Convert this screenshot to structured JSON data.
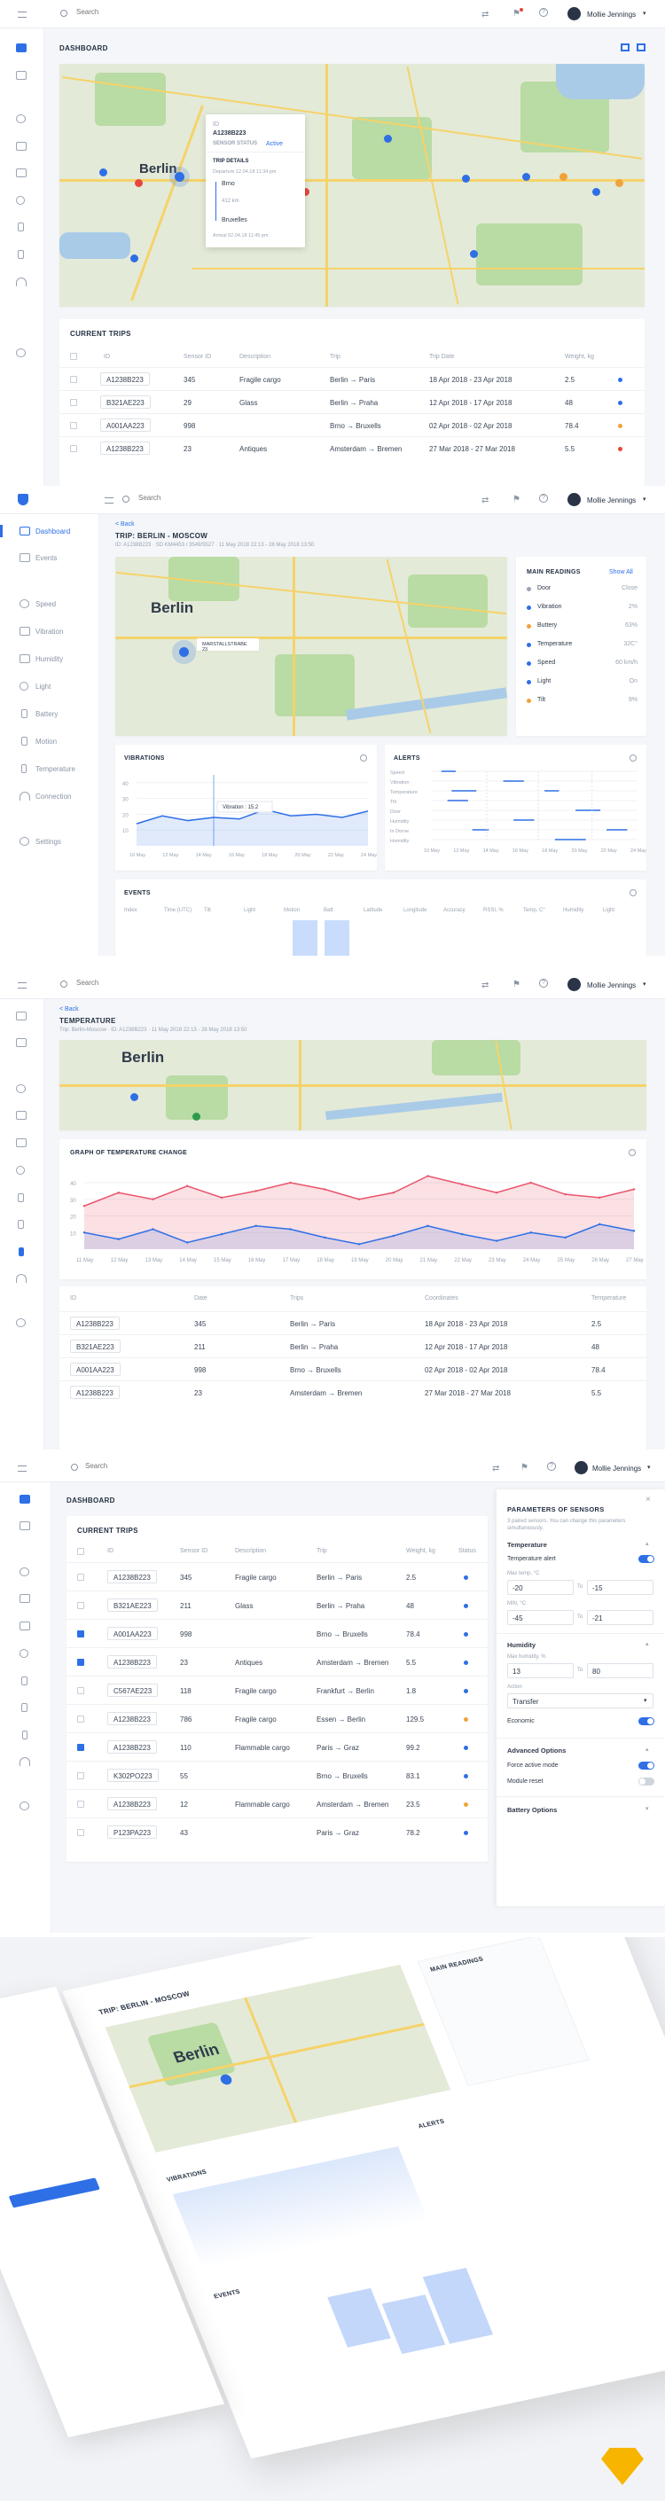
{
  "user": {
    "name": "Mollie Jennings"
  },
  "search": {
    "placeholder": "Search"
  },
  "dashboard": {
    "title": "DASHBOARD",
    "map": {
      "city_label": "Berlin",
      "popup": {
        "id_label": "ID",
        "id_value": "A1238B223",
        "status_label": "SENSOR STATUS",
        "status_value": "Active",
        "details_label": "TRIP DETAILS",
        "departure": "Departure 12.04.18 11:34 pm",
        "from": "Brno",
        "distance": "412 km",
        "to": "Bruxelles",
        "arrival": "Arrival 02.04.18 11:45 pm"
      }
    },
    "trips_title": "CURRENT TRIPS",
    "columns": [
      "ID",
      "Sensor ID",
      "Description",
      "Trip",
      "Trip Date",
      "Weight, kg"
    ],
    "rows": [
      {
        "id": "A1238B223",
        "sensor": "345",
        "desc": "Fragile cargo",
        "trip": "Berlin → Paris",
        "date": "18 Apr 2018 - 23 Apr 2018",
        "weight": "2.5",
        "status": "#2e6fe6"
      },
      {
        "id": "B321AE223",
        "sensor": "29",
        "desc": "Glass",
        "trip": "Berlin → Praha",
        "date": "12 Apr 2018 - 17 Apr 2018",
        "weight": "48",
        "status": "#2e6fe6"
      },
      {
        "id": "A001AA223",
        "sensor": "998",
        "desc": "",
        "trip": "Brno → Bruxells",
        "date": "02 Apr 2018 - 02 Apr 2018",
        "weight": "78.4",
        "status": "#f0a23b"
      },
      {
        "id": "A1238B223",
        "sensor": "23",
        "desc": "Antiques",
        "trip": "Amsterdam → Bremen",
        "date": "27 Mar 2018 - 27 Mar 2018",
        "weight": "5.5",
        "status": "#e8453c"
      }
    ]
  },
  "trip": {
    "back": "< Back",
    "title": "TRIP: BERLIN - MOSCOW",
    "meta": "ID: A1238B223 · SD KM4453 / 3549/5527 · 11 May 2018 22:13 - 28 May 2018 13:50",
    "sidebar": [
      "Dashboard",
      "Events",
      "Speed",
      "Vibration",
      "Humidity",
      "Light",
      "Battery",
      "Motion",
      "Temperature",
      "Connection",
      "Settings"
    ],
    "readings_title": "MAIN READINGS",
    "show_all": "Show All",
    "readings": [
      {
        "name": "Door",
        "value": "Close"
      },
      {
        "name": "Vibration",
        "value": "2%"
      },
      {
        "name": "Buttery",
        "value": "63%"
      },
      {
        "name": "Temperature",
        "value": "32C°"
      },
      {
        "name": "Speed",
        "value": "60 km/h"
      },
      {
        "name": "Light",
        "value": "On"
      },
      {
        "name": "Tilt",
        "value": "9%"
      }
    ],
    "map_tooltip": "MARSTALLSTRABE 23",
    "vibrations_title": "VIBRATIONS",
    "vib_tooltip": "Vibration : 15.2",
    "alerts_title": "ALERTS",
    "alert_rows": [
      "Speed",
      "Vibration",
      "Temperature",
      "Tilt",
      "Door",
      "Humidity",
      "In Dorne",
      "Humidity"
    ],
    "events_title": "EVENTS",
    "event_cols": [
      "Index",
      "Time (UTC)",
      "Tilt",
      "Light",
      "Motion",
      "Batt",
      "Latitude",
      "Longitude",
      "Accuracy",
      "RSSI, %",
      "Temp, C°",
      "Humidity",
      "Light"
    ]
  },
  "temperature": {
    "back": "< Back",
    "title": "TEMPERATURE",
    "meta": "Trip: Berlin-Moscow · ID: A1238B223 · 11 May 2018 22:13 - 28 May 2018 13:50",
    "graph_title": "GRAPH OF TEMPERATURE CHANGE",
    "columns": [
      "ID",
      "Date",
      "Trips",
      "Coordinates",
      "Temperature"
    ],
    "rows": [
      {
        "id": "A1238B223",
        "date": "345",
        "trip": "Berlin → Paris",
        "coords": "18 Apr 2018 - 23 Apr 2018",
        "temp": "2.5"
      },
      {
        "id": "B321AE223",
        "date": "211",
        "trip": "Berlin → Praha",
        "coords": "12 Apr 2018 - 17 Apr 2018",
        "temp": "48"
      },
      {
        "id": "A001AA223",
        "date": "998",
        "trip": "Brno → Bruxells",
        "coords": "02 Apr 2018 - 02 Apr 2018",
        "temp": "78.4"
      },
      {
        "id": "A1238B223",
        "date": "23",
        "trip": "Amsterdam → Bremen",
        "coords": "27 Mar 2018 - 27 Mar 2018",
        "temp": "5.5"
      }
    ]
  },
  "chart_data": {
    "type": "line",
    "x": [
      "11 May",
      "12 May",
      "13 May",
      "14 May",
      "15 May",
      "16 May",
      "17 May",
      "18 May",
      "19 May",
      "20 May",
      "21 May",
      "22 May",
      "23 May",
      "24 May",
      "25 May",
      "26 May",
      "27 May"
    ],
    "series": [
      {
        "values": [
          26,
          34,
          30,
          38,
          31,
          35,
          40,
          36,
          30,
          34,
          44,
          39,
          34,
          40,
          33,
          31,
          36
        ]
      },
      {
        "values": [
          10,
          6,
          12,
          4,
          9,
          14,
          12,
          7,
          3,
          8,
          14,
          9,
          5,
          10,
          7,
          15,
          11
        ]
      }
    ],
    "yticks": [
      "40",
      "30",
      "20",
      "10"
    ],
    "ylim": [
      0,
      48
    ]
  },
  "vibration_chart": {
    "x": [
      "10 May",
      "12 May",
      "14 May",
      "16 May",
      "18 May",
      "20 May",
      "22 May",
      "24 May"
    ],
    "values": [
      14,
      19,
      16,
      18,
      17,
      23,
      19,
      20,
      18,
      22
    ],
    "yticks": [
      "40",
      "30",
      "20",
      "10"
    ]
  },
  "alert_chart": {
    "x": [
      "10 May",
      "12 May",
      "14 May",
      "16 May",
      "18 May",
      "20 May",
      "22 May",
      "24 May"
    ]
  },
  "sensors": {
    "title": "PARAMETERS OF SENSORS",
    "subtitle": "3 paired sensors. You can change this parameters simultaneously.",
    "temperature_label": "Temperature",
    "temp_alert": "Temperature alert",
    "max_temp": "Max temp, °C",
    "min_temp": "MIN, °C",
    "from_label": "From",
    "to_label": "To",
    "t_max_from": "-20",
    "t_max_to": "-15",
    "t_min_from": "-45",
    "t_min_to": "-21",
    "humidity_label": "Humidity",
    "max_humidity": "Max humidity, %",
    "h_from": "13",
    "h_to": "80",
    "action_label": "Action",
    "action_value": "Transfer",
    "economic": "Economic",
    "advanced": "Advanced Options",
    "force_active": "Force active mode",
    "module_reset": "Module reset",
    "battery": "Battery Options"
  },
  "dash2": {
    "title": "DASHBOARD",
    "trips_title": "CURRENT TRIPS",
    "columns": [
      "ID",
      "Sensor ID",
      "Description",
      "Trip",
      "Weight, kg",
      "Status"
    ],
    "rows": [
      {
        "id": "A1238B223",
        "sensor": "345",
        "desc": "Fragile cargo",
        "trip": "Berlin → Paris",
        "weight": "2.5",
        "checked": false,
        "status": "#2e6fe6"
      },
      {
        "id": "B321AE223",
        "sensor": "211",
        "desc": "Glass",
        "trip": "Berlin → Praha",
        "weight": "48",
        "checked": false,
        "status": "#2e6fe6"
      },
      {
        "id": "A001AA223",
        "sensor": "998",
        "desc": "",
        "trip": "Brno → Bruxells",
        "weight": "78.4",
        "checked": true,
        "status": "#2e6fe6"
      },
      {
        "id": "A1238B223",
        "sensor": "23",
        "desc": "Antiques",
        "trip": "Amsterdam → Bremen",
        "weight": "5.5",
        "checked": true,
        "status": "#2e6fe6"
      },
      {
        "id": "C567AE223",
        "sensor": "118",
        "desc": "Fragile cargo",
        "trip": "Frankfurt → Berlin",
        "weight": "1.8",
        "checked": false,
        "status": "#2e6fe6"
      },
      {
        "id": "A1238B223",
        "sensor": "786",
        "desc": "Fragile cargo",
        "trip": "Essen → Berlin",
        "weight": "129.5",
        "checked": false,
        "status": "#f0a23b"
      },
      {
        "id": "A1238B223",
        "sensor": "110",
        "desc": "Flammable cargo",
        "trip": "Paris → Graz",
        "weight": "99.2",
        "checked": true,
        "status": "#2e6fe6"
      },
      {
        "id": "K302PO223",
        "sensor": "55",
        "desc": "",
        "trip": "Brno → Bruxells",
        "weight": "83.1",
        "checked": false,
        "status": "#2e6fe6"
      },
      {
        "id": "A1238B223",
        "sensor": "12",
        "desc": "Flammable cargo",
        "trip": "Amsterdam → Bremen",
        "weight": "23.5",
        "checked": false,
        "status": "#f0a23b"
      },
      {
        "id": "P123PA223",
        "sensor": "43",
        "desc": "",
        "trip": "Paris → Graz",
        "weight": "78.2",
        "checked": false,
        "status": "#2e6fe6"
      }
    ]
  },
  "colors": {
    "accent": "#2e6fe6",
    "warning": "#f0a23b",
    "danger": "#e8453c",
    "red_line": "#e9546b"
  }
}
